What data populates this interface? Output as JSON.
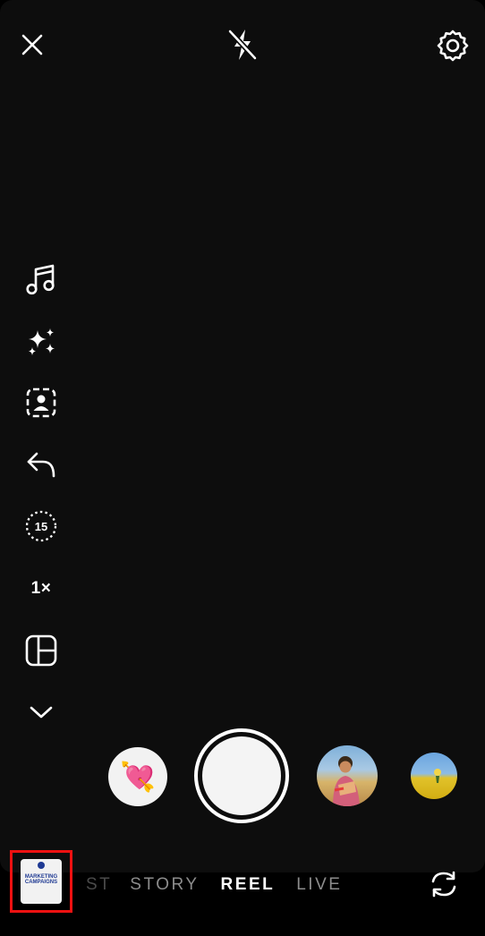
{
  "top_bar": {
    "close_icon": "close-icon",
    "flash_icon": "flash-off-icon",
    "settings_icon": "settings-gear-icon"
  },
  "side_tools": [
    {
      "name": "music",
      "icon": "music-note-icon"
    },
    {
      "name": "effects",
      "icon": "sparkles-icon"
    },
    {
      "name": "green-screen",
      "icon": "person-frame-icon"
    },
    {
      "name": "undo",
      "icon": "undo-arrow-icon"
    },
    {
      "name": "timer",
      "icon": "timer-icon",
      "label": "15"
    },
    {
      "name": "speed",
      "label": "1×"
    },
    {
      "name": "layout",
      "icon": "layout-grid-icon"
    },
    {
      "name": "more",
      "icon": "chevron-down-icon"
    }
  ],
  "effects_row": {
    "left_effect_icon": "heart-with-arrow-emoji",
    "left_effect_glyph": "💘",
    "right_effect_1": "person-photo-effect",
    "right_effect_2": "yellow-field-effect"
  },
  "modes": {
    "faded": "ST",
    "story": "STORY",
    "reel": "REEL",
    "live": "LIVE",
    "active": "REEL"
  },
  "gallery": {
    "thumb_text": "MARKETING\nCAMPAIGNS",
    "highlight_color": "#e11111"
  },
  "flip_camera_icon": "flip-camera-icon"
}
